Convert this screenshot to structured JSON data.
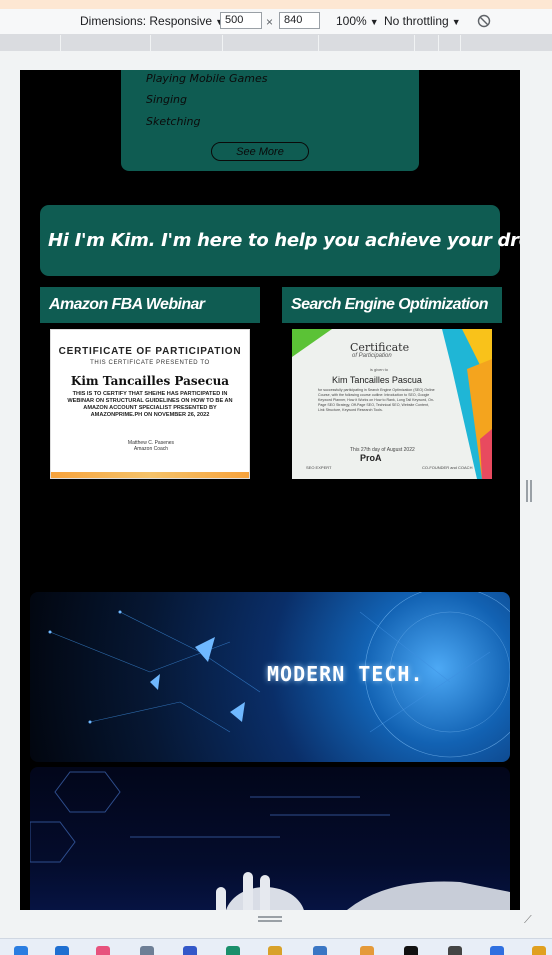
{
  "devtools": {
    "dimensions_label": "Dimensions: Responsive",
    "width_value": "500",
    "times": "×",
    "height_value": "840",
    "zoom": "100%",
    "throttling": "No throttling"
  },
  "hobbies": {
    "items": [
      "Playing Mobile Games",
      "Singing",
      "Sketching"
    ],
    "see_more": "See More"
  },
  "greeting": "Hi I'm Kim. I'm here to help you achieve your dream life...",
  "certificates": [
    {
      "title": "Amazon FBA Webinar",
      "heading": "CERTIFICATE OF PARTICIPATION",
      "presented": "THIS CERTIFICATE PRESENTED TO",
      "name": "Kim Tancailles Pasecua",
      "body": "THIS IS TO CERTIFY THAT SHE/HE HAS PARTICIPATED IN WEBINAR ON STRUCTURAL GUIDELINES ON HOW TO BE AN AMAZON ACCOUNT SPECIALIST PRESENTED BY AMAZONPRIME.PH ON NOVEMBER 26, 2022",
      "signer": "Matthew C. Pasenes Amazon Coach"
    },
    {
      "title": "Search Engine Optimization",
      "heading": "Certificate",
      "subheading": "of Participation",
      "presented": "is given to",
      "name": "Kim Tancailles Pascua",
      "body": "for successfully participating in Search Engine Optimization (SEO) Online Course, with the following course outline: Introduction to SEO, Google Keyword Planner, How it Works on How to Rank, Long Tail Keyword, On-Page SEO Strategy, Off-Page SEO, Technical SEO, Website Content, Link Structure, Keyword Research Tools.",
      "date": "This 27th day of August 2022",
      "logo": "ProA",
      "signer_left": "SEO EXPERT",
      "signer_right": "CO-FOUNDER and COACH"
    }
  ],
  "banner": {
    "text": "MODERN TECH."
  }
}
